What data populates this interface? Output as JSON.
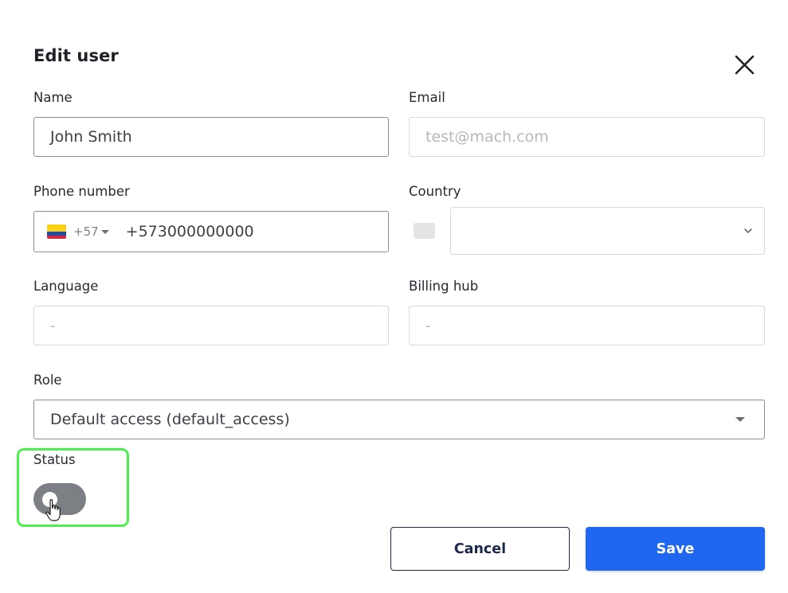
{
  "dialog": {
    "title": "Edit user"
  },
  "form": {
    "name": {
      "label": "Name",
      "value": "John Smith"
    },
    "email": {
      "label": "Email",
      "placeholder": "test@mach.com"
    },
    "phone": {
      "label": "Phone number",
      "dial_code": "+57",
      "value": "+573000000000"
    },
    "country": {
      "label": "Country",
      "value": ""
    },
    "language": {
      "label": "Language",
      "value": "-"
    },
    "billing_hub": {
      "label": "Billing hub",
      "value": "-"
    },
    "role": {
      "label": "Role",
      "value": "Default access (default_access)"
    },
    "status": {
      "label": "Status",
      "enabled": false
    }
  },
  "actions": {
    "cancel_label": "Cancel",
    "save_label": "Save"
  },
  "icons": {
    "close": "close-icon",
    "flag": "colombia-flag-icon",
    "dropdown": "chevron-down-icon",
    "cursor": "hand-pointer-icon"
  },
  "colors": {
    "primary": "#1f67f1",
    "highlight": "#4cf04c",
    "toggle_off": "#7c7f84"
  }
}
